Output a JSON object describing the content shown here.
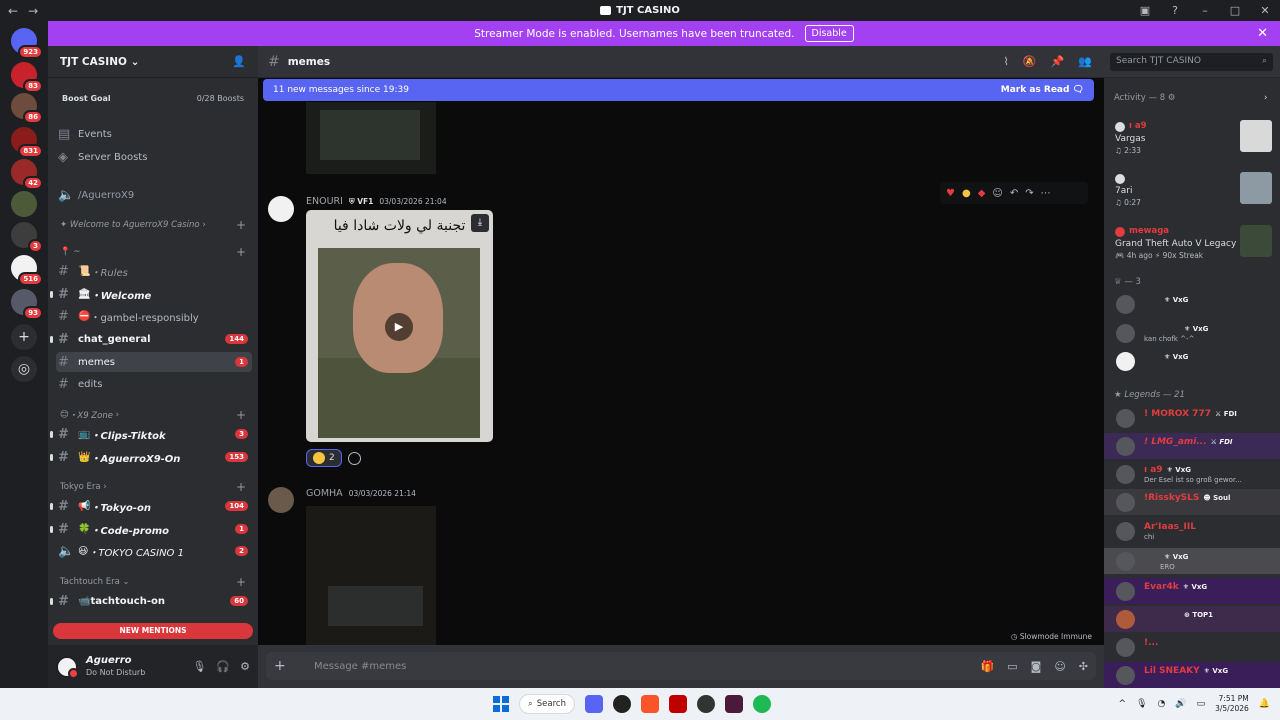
{
  "window": {
    "title": "TJT CASINO",
    "back": "←",
    "forward": "→"
  },
  "banner": {
    "text": "Streamer Mode is enabled. Usernames have been truncated.",
    "button": "Disable"
  },
  "guild_badges": [
    "923",
    "83",
    "86",
    "831",
    "42",
    "3",
    "516",
    "93"
  ],
  "server": {
    "name": "TJT CASINO",
    "boost_goal": "Boost Goal",
    "boost_count": "0/28 Boosts"
  },
  "channels": {
    "events": "Events",
    "server_boosts": "Server Boosts",
    "voice_aguerro": "/AguerroX9",
    "cat_welcome": "Welcome to AguerroX9 Casino",
    "cat_pin": "📍 ~",
    "rules": "・Rules",
    "welcome": "・Welcome",
    "gambel": "・gambel-responsibly",
    "chat_general": "chat_general",
    "chat_general_count": "144",
    "memes": "memes",
    "memes_count": "1",
    "edits": "edits",
    "cat_x9zone": "・X9 Zone",
    "clips": "・Clips-Tiktok",
    "clips_count": "3",
    "aguerrox9on": "・AguerroX9-On",
    "aguerrox9on_count": "153",
    "cat_tokyo": "Tokyo Era",
    "tokyo_on": "・Tokyo-on",
    "tokyo_on_count": "104",
    "code_promo": "・Code-promo",
    "code_promo_count": "1",
    "tokyo_casino": "・TOKYO CASINO 1",
    "tokyo_casino_count": "2",
    "cat_tachtouch": "Tachtouch Era",
    "tachtouch_on": "tachtouch-on",
    "tachtouch_on_count": "60",
    "new_mentions": "NEW MENTIONS"
  },
  "user": {
    "name": "Aguerro",
    "status": "Do Not Disturb"
  },
  "chat": {
    "channel": "memes",
    "search_placeholder": "Search TJT CASINO",
    "new_messages": "11 new messages since 19:39",
    "mark_read": "Mark as Read",
    "messages": [
      {
        "author": "ENOURI",
        "tag": "VF1",
        "time": "03/03/2026 21:04",
        "caption": "تجنبة لي ولات شادا فيا",
        "reaction_count": "2"
      },
      {
        "author": "GOMHA",
        "time": "03/03/2026 21:14"
      }
    ],
    "slowmode": "Slowmode Immune",
    "composer_placeholder": "Message #memes"
  },
  "members": {
    "activity_header": "Activity — 8",
    "activities": [
      {
        "n1": "ı a9",
        "n2": "Vargas",
        "n3": "♫ 2:33"
      },
      {
        "n1": "",
        "n2": "7ari",
        "n3": "♫ 0:27"
      },
      {
        "n1": "mewaga",
        "n2": "Grand Theft Auto V Legacy",
        "n3": "🎮 4h ago  ⚡ 90x Streak"
      }
    ],
    "group1_header": "— 3",
    "group1": [
      {
        "name": "",
        "tag": "VxG",
        "status": ""
      },
      {
        "name": "",
        "tag": "VxG",
        "status": "kan chofk ^-^"
      },
      {
        "name": "",
        "tag": "VxG",
        "status": ""
      }
    ],
    "legends_header": "Legends — 21",
    "legends": [
      {
        "name": "! MOROX 777",
        "tag": "FDI",
        "status": ""
      },
      {
        "name": "! LMG_ami...",
        "tag": "FDI",
        "status": ""
      },
      {
        "name": "ı a9",
        "tag": "VxG",
        "status": "Der Esel ist so groß gewor..."
      },
      {
        "name": "!RisskySLS",
        "tag": "Soul",
        "status": ""
      },
      {
        "name": "Ar'Iaas_IIL",
        "tag": "",
        "status": "chi"
      },
      {
        "name": "",
        "tag": "VxG",
        "status": "ERO"
      },
      {
        "name": "Evar4k",
        "tag": "VxG",
        "status": ""
      },
      {
        "name": "",
        "tag": "TOP1",
        "status": ""
      },
      {
        "name": "!...",
        "tag": "",
        "status": ""
      },
      {
        "name": "Lil SNEAKY",
        "tag": "VxG",
        "status": ""
      }
    ]
  },
  "taskbar": {
    "search": "Search",
    "time": "7:51 PM",
    "date": "3/5/2026"
  }
}
